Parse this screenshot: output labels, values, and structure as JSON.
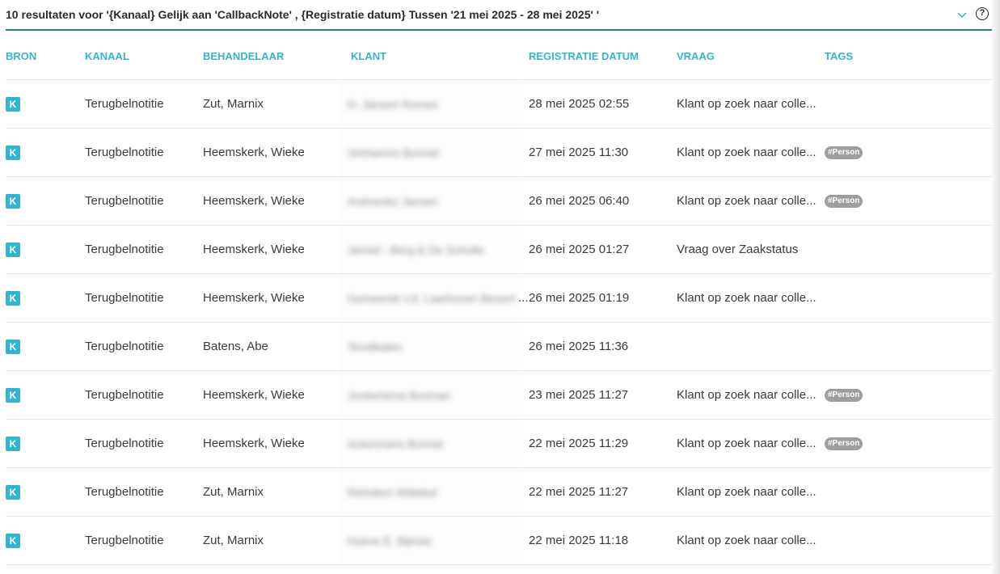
{
  "header": {
    "title": "10 resultaten voor '{Kanaal} Gelijk aan 'CallbackNote' , {Registratie datum} Tussen '21 mei 2025 - 28 mei 2025' '",
    "help_label": "?"
  },
  "columns": {
    "bron": "BRON",
    "kanaal": "KANAAL",
    "behandelaar": "BEHANDELAAR",
    "klant": "KLANT",
    "registratie_datum": "REGISTRATIE DATUM",
    "vraag": "VRAAG",
    "tags": "TAGS"
  },
  "colors": {
    "accent": "#35b4cf",
    "header_rule": "#2e7a84",
    "tag": "#9e9e9e"
  },
  "rows": [
    {
      "bron": "K",
      "kanaal": "Terugbelnotitie",
      "behandelaar": "Zut, Marnix",
      "klant": "H. Jansen Romeo",
      "datum": "28 mei 2025 02:55",
      "vraag": "Klant op zoek naar colle...",
      "tag": "",
      "klant_overflow": ""
    },
    {
      "bron": "K",
      "kanaal": "Terugbelnotitie",
      "behandelaar": "Heemskerk, Wieke",
      "klant": "Verhaeren Bonnet",
      "datum": "27 mei 2025 11:30",
      "vraag": "Klant op zoek naar colle...",
      "tag": "#Person",
      "klant_overflow": ""
    },
    {
      "bron": "K",
      "kanaal": "Terugbelnotitie",
      "behandelaar": "Heemskerk, Wieke",
      "klant": "Aramesku Jansen",
      "datum": "26 mei 2025 06:40",
      "vraag": "Klant op zoek naar colle...",
      "tag": "#Person",
      "klant_overflow": ""
    },
    {
      "bron": "K",
      "kanaal": "Terugbelnotitie",
      "behandelaar": "Heemskerk, Wieke",
      "klant": "Jansel - Berg & De Schutte",
      "datum": "26 mei 2025 01:27",
      "vraag": "Vraag over Zaakstatus",
      "tag": "",
      "klant_overflow": ""
    },
    {
      "bron": "K",
      "kanaal": "Terugbelnotitie",
      "behandelaar": "Heemskerk, Wieke",
      "klant": "Gemeente v.d. Laarhoven Bezem",
      "datum": "26 mei 2025 01:19",
      "vraag": "Klant op zoek naar colle...",
      "tag": "",
      "klant_overflow": "..."
    },
    {
      "bron": "K",
      "kanaal": "Terugbelnotitie",
      "behandelaar": "Batens, Abe",
      "klant": "Tevelkaten",
      "datum": "26 mei 2025 11:36",
      "vraag": "",
      "tag": "",
      "klant_overflow": ""
    },
    {
      "bron": "K",
      "kanaal": "Terugbelnotitie",
      "behandelaar": "Heemskerk, Wieke",
      "klant": "Jonkertsma Bosman",
      "datum": "23 mei 2025 11:27",
      "vraag": "Klant op zoek naar colle...",
      "tag": "#Person",
      "klant_overflow": ""
    },
    {
      "bron": "K",
      "kanaal": "Terugbelnotitie",
      "behandelaar": "Heemskerk, Wieke",
      "klant": "Ackermans Bonnet",
      "datum": "22 mei 2025 11:29",
      "vraag": "Klant op zoek naar colle...",
      "tag": "#Person",
      "klant_overflow": ""
    },
    {
      "bron": "K",
      "kanaal": "Terugbelnotitie",
      "behandelaar": "Zut, Marnix",
      "klant": "Reinders Wittebol",
      "datum": "22 mei 2025 11:27",
      "vraag": "Klant op zoek naar colle...",
      "tag": "",
      "klant_overflow": ""
    },
    {
      "bron": "K",
      "kanaal": "Terugbelnotitie",
      "behandelaar": "Zut, Marnix",
      "klant": "Hoeve E. Bijman",
      "datum": "22 mei 2025 11:18",
      "vraag": "Klant op zoek naar colle...",
      "tag": "",
      "klant_overflow": ""
    }
  ]
}
